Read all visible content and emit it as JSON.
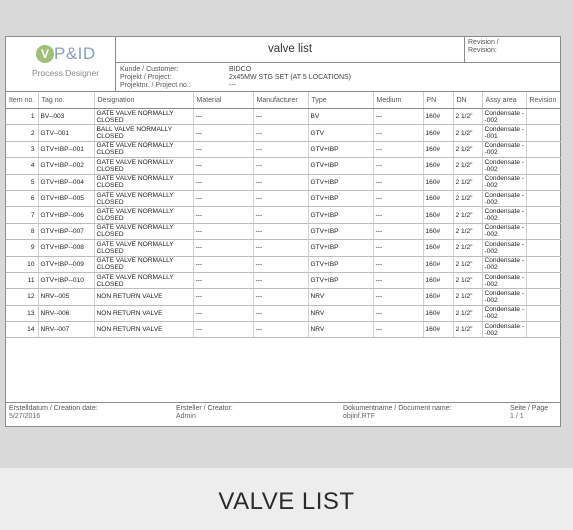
{
  "logo": {
    "mark": "V",
    "name": "P&ID",
    "sub": "Process Designer"
  },
  "title": "valve list",
  "revision": {
    "line1": "Revision /",
    "line2": "Revision:"
  },
  "meta": [
    {
      "label": "Kunde / Customer:",
      "value": "BIDCO"
    },
    {
      "label": "Projekt / Project:",
      "value": "2x45MW STG SET (AT 5 LOCATIONS)"
    },
    {
      "label": "Projektnr. / Project no.:",
      "value": "---"
    }
  ],
  "columns": [
    "Item no.",
    "Tag no.",
    "Designation",
    "Material",
    "Manufacturer",
    "Type",
    "Medium",
    "PN",
    "DN",
    "Assy area",
    "Revision"
  ],
  "rows": [
    [
      "1",
      "BV--003",
      "GATE VALVE NORMALLY CLOSED",
      "---",
      "---",
      "BV",
      "---",
      "160#",
      "2 1/2\"",
      "Condensate --002",
      ""
    ],
    [
      "2",
      "GTV--001",
      "BALL VALVE NORMALLY CLOSED",
      "---",
      "---",
      "GTV",
      "---",
      "160#",
      "2 1/2\"",
      "Condensate --001",
      ""
    ],
    [
      "3",
      "GTV+IBP--001",
      "GATE VALVE NORMALLY CLOSED",
      "---",
      "---",
      "GTV+IBP",
      "---",
      "160#",
      "2 1/2\"",
      "Condensate --002",
      ""
    ],
    [
      "4",
      "GTV+IBP--002",
      "GATE VALVE NORMALLY CLOSED",
      "---",
      "---",
      "GTV+IBP",
      "---",
      "160#",
      "2 1/2\"",
      "Condensate --002",
      ""
    ],
    [
      "5",
      "GTV+IBP--004",
      "GATE VALVE NORMALLY CLOSED",
      "---",
      "---",
      "GTV+IBP",
      "---",
      "160#",
      "2 1/2\"",
      "Condensate --002",
      ""
    ],
    [
      "6",
      "GTV+IBP--005",
      "GATE VALVE NORMALLY CLOSED",
      "---",
      "---",
      "GTV+IBP",
      "---",
      "160#",
      "2 1/2\"",
      "Condensate --002",
      ""
    ],
    [
      "7",
      "GTV+IBP--006",
      "GATE VALVE NORMALLY CLOSED",
      "---",
      "---",
      "GTV+IBP",
      "---",
      "160#",
      "2 1/2\"",
      "Condensate --002",
      ""
    ],
    [
      "8",
      "GTV+IBP--007",
      "GATE VALVE NORMALLY CLOSED",
      "---",
      "---",
      "GTV+IBP",
      "---",
      "160#",
      "2 1/2\"",
      "Condensate --002",
      ""
    ],
    [
      "9",
      "GTV+IBP--008",
      "GATE VALVE NORMALLY CLOSED",
      "---",
      "---",
      "GTV+IBP",
      "---",
      "160#",
      "2 1/2\"",
      "Condensate --002",
      ""
    ],
    [
      "10",
      "GTV+IBP--009",
      "GATE VALVE NORMALLY CLOSED",
      "---",
      "---",
      "GTV+IBP",
      "---",
      "160#",
      "2 1/2\"",
      "Condensate --002",
      ""
    ],
    [
      "11",
      "GTV+IBP--010",
      "GATE VALVE NORMALLY CLOSED",
      "---",
      "---",
      "GTV+IBP",
      "---",
      "160#",
      "2 1/2\"",
      "Condensate --002",
      ""
    ],
    [
      "12",
      "NRV--005",
      "NON RETURN VALVE",
      "---",
      "---",
      "NRV",
      "---",
      "160#",
      "2 1/2\"",
      "Condensate --002",
      ""
    ],
    [
      "13",
      "NRV--006",
      "NON RETURN VALVE",
      "---",
      "---",
      "NRV",
      "---",
      "160#",
      "2 1/2\"",
      "Condensate --002",
      ""
    ],
    [
      "14",
      "NRV--007",
      "NON RETURN VALVE",
      "---",
      "---",
      "NRV",
      "---",
      "160#",
      "2 1/2\"",
      "Condensate --002",
      ""
    ]
  ],
  "footer": {
    "created_label": "Erstelldatum / Creation date:",
    "created_value": "5/27/2016",
    "creator_label": "Ersteller / Creator:",
    "creator_value": "Admin",
    "docname_label": "Dokumentname / Document name:",
    "docname_value": "objinf.RTF",
    "page_label": "Seite / Page",
    "page_value": "1 / 1"
  },
  "caption": "VALVE LIST"
}
